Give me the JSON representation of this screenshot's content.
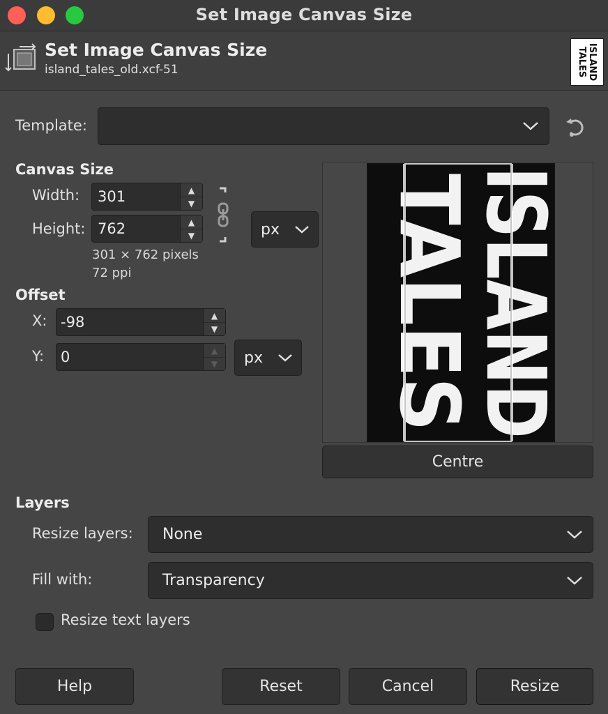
{
  "window": {
    "title": "Set Image Canvas Size"
  },
  "header": {
    "title": "Set Image Canvas Size",
    "subtitle": "island_tales_old.xcf-51",
    "thumbnail_text": "ISLAND TALES"
  },
  "template": {
    "label": "Template:",
    "value": ""
  },
  "canvas_size": {
    "heading": "Canvas Size",
    "width_label": "Width:",
    "width_value": "301",
    "height_label": "Height:",
    "height_value": "762",
    "unit": "px",
    "info_pixels": "301 × 762 pixels",
    "info_ppi": "72 ppi"
  },
  "offset": {
    "heading": "Offset",
    "x_label": "X:",
    "x_value": "-98",
    "y_label": "Y:",
    "y_value": "0",
    "unit": "px"
  },
  "preview": {
    "image_text": "ISLAND TALES",
    "centre_label": "Centre"
  },
  "layers": {
    "heading": "Layers",
    "resize_label": "Resize layers:",
    "resize_value": "None",
    "fill_label": "Fill with:",
    "fill_value": "Transparency",
    "resize_text_label": "Resize text layers",
    "resize_text_checked": false
  },
  "buttons": {
    "help": "Help",
    "reset": "Reset",
    "cancel": "Cancel",
    "resize": "Resize"
  },
  "colors": {
    "close": "#fe5f57",
    "minimize": "#febc2e",
    "maximize": "#28c840",
    "background": "#454545"
  }
}
